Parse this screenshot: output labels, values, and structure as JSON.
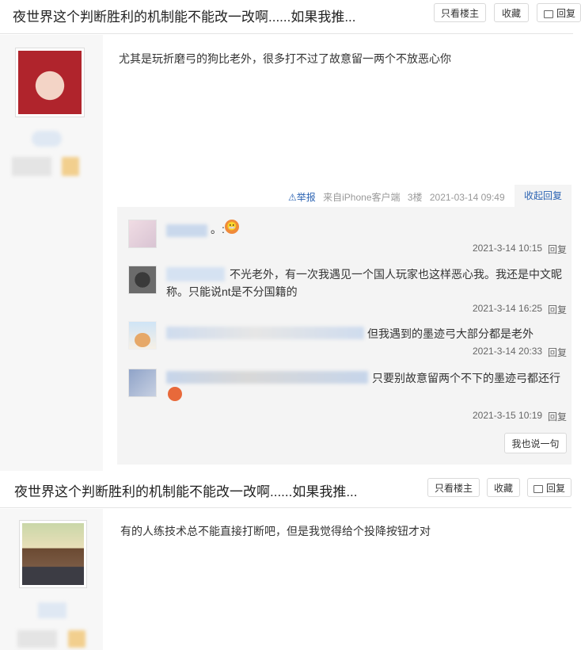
{
  "thread_title": "夜世界这个判断胜利的机制能不能改一改啊......如果我推...",
  "buttons": {
    "only_lz": "只看楼主",
    "collect": "收藏",
    "reply": "回复",
    "reply_clip": "回复"
  },
  "post1": {
    "content": "尤其是玩折磨弓的狗比老外，很多打不过了故意留一两个不放恶心你",
    "report": "举报",
    "client": "来自iPhone客户端",
    "floor": "3楼",
    "date": "2021-03-14 09:49",
    "collapse": "收起回复",
    "comments": [
      {
        "text": "。:",
        "time": "2021-3-14 10:15",
        "reply": "回复"
      },
      {
        "text": "不光老外，有一次我遇见一个国人玩家也这样恶心我。我还是中文昵称。只能说nt是不分国籍的",
        "time": "2021-3-14 16:25",
        "reply": "回复"
      },
      {
        "text": "但我遇到的墨迹弓大部分都是老外",
        "time": "2021-3-14 20:33",
        "reply": "回复"
      },
      {
        "text": "只要别故意留两个不下的墨迹弓都还行",
        "time": "2021-3-15 10:19",
        "reply": "回复"
      }
    ],
    "say_btn": "我也说一句"
  },
  "post2": {
    "content": "有的人练技术总不能直接打断吧，但是我觉得给个投降按钮才对"
  },
  "colors": {
    "link": "#2d64b3",
    "sub_bg": "#f4f4f4",
    "left_bg": "#f7f7f7"
  },
  "icons": [
    "warning-icon",
    "reply-bubble-icon",
    "angry-emoji-icon",
    "fire-emoji-icon"
  ]
}
